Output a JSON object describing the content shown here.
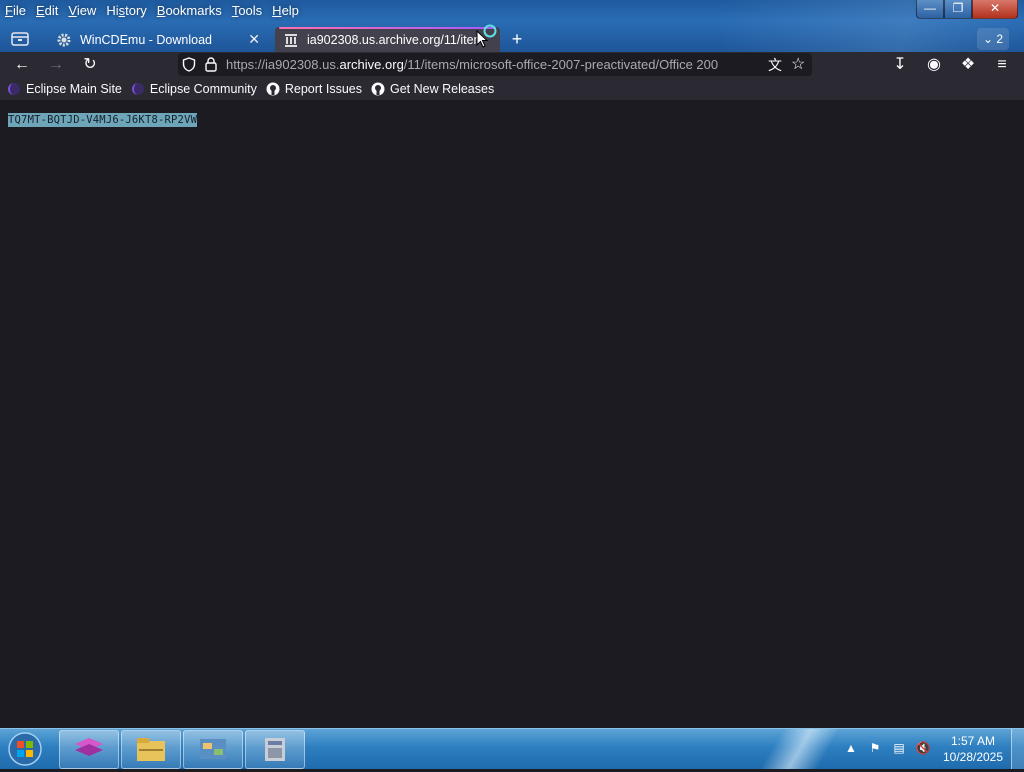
{
  "menubar": {
    "items": [
      {
        "pre": "",
        "ul": "F",
        "post": "ile"
      },
      {
        "pre": "",
        "ul": "E",
        "post": "dit"
      },
      {
        "pre": "",
        "ul": "V",
        "post": "iew"
      },
      {
        "pre": "Hi",
        "ul": "s",
        "post": "tory"
      },
      {
        "pre": "",
        "ul": "B",
        "post": "ookmarks"
      },
      {
        "pre": "",
        "ul": "T",
        "post": "ools"
      },
      {
        "pre": "",
        "ul": "H",
        "post": "elp"
      }
    ]
  },
  "tabs": [
    {
      "title": "WinCDEmu - Download",
      "icon": "gear-icon",
      "active": false
    },
    {
      "title": "ia902308.us.archive.org/11/item",
      "icon": "archive-icon",
      "active": true
    }
  ],
  "tab_count": "2",
  "navbar": {
    "url_prefix": "https://ia902308.us.",
    "url_host": "archive.org",
    "url_rest": "/11/items/microsoft-office-2007-preactivated/Office 200"
  },
  "bookmarks": [
    {
      "label": "Eclipse Main Site",
      "icon": "eclipse-icon"
    },
    {
      "label": "Eclipse Community",
      "icon": "eclipse-icon"
    },
    {
      "label": "Report Issues",
      "icon": "github-icon"
    },
    {
      "label": "Get New Releases",
      "icon": "github-icon"
    }
  ],
  "content": {
    "selected_text": "TQ7MT-BQTJD-V4MJ6-J6KT8-RP2VW"
  },
  "taskbar": {
    "apps": [
      "visual-studio-icon",
      "file-explorer-icon",
      "control-panel-icon",
      "installer-icon"
    ],
    "clock_time": "1:57 AM",
    "clock_date": "10/28/2025"
  },
  "colors": {
    "content_bg": "#1c1b22",
    "toolbar_bg": "#2b2a33",
    "selection_bg": "#6fa5b8",
    "tab_accent": "#a45bff"
  }
}
